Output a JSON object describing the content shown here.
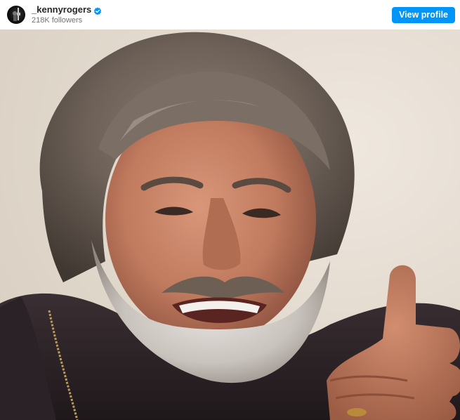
{
  "header": {
    "username": "_kennyrogers",
    "followers": "218K followers",
    "view_profile_label": "View profile"
  },
  "icons": {
    "avatar": "profile-avatar",
    "verified": "verified-badge-icon"
  },
  "colors": {
    "accent": "#0095f6",
    "username": "#262626",
    "secondary_text": "#737373",
    "photo_background": "#e9e2d8"
  }
}
